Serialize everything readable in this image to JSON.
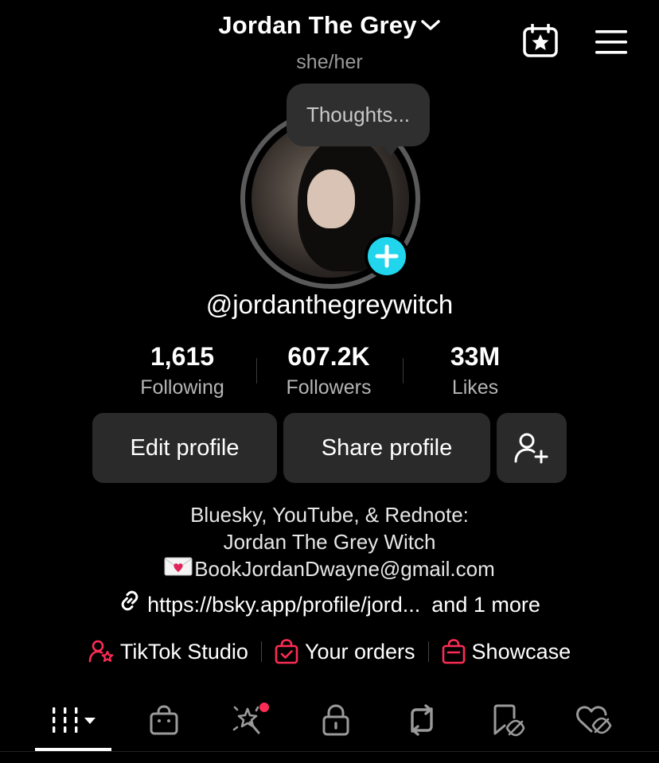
{
  "header": {
    "display_name": "Jordan The Grey",
    "pronouns": "she/her",
    "calendar_icon": "calendar-star-icon",
    "menu_icon": "hamburger-menu-icon"
  },
  "thought_bubble": {
    "text": "Thoughts..."
  },
  "profile": {
    "handle": "@jordanthegreywitch",
    "avatar_alt": "profile photo",
    "add_badge_color": "#20d5ec"
  },
  "stats": [
    {
      "value": "1,615",
      "label": "Following"
    },
    {
      "value": "607.2K",
      "label": "Followers"
    },
    {
      "value": "33M",
      "label": "Likes"
    }
  ],
  "actions": {
    "edit_profile": "Edit profile",
    "share_profile": "Share profile",
    "add_friend_icon": "add-user-icon"
  },
  "bio": {
    "line1": "Bluesky, YouTube, & Rednote:",
    "line2": "Jordan The Grey Witch",
    "line3": "BookJordanDwayne@gmail.com"
  },
  "link": {
    "url": "https://bsky.app/profile/jord...",
    "more": "and 1 more"
  },
  "tools": [
    {
      "label": "TikTok Studio",
      "icon": "creator-star-icon"
    },
    {
      "label": "Your orders",
      "icon": "shopping-bag-check-icon"
    },
    {
      "label": "Showcase",
      "icon": "shopping-bag-icon"
    }
  ],
  "tabs": [
    {
      "icon": "videos-grid-icon",
      "active": true
    },
    {
      "icon": "shop-bag-icon"
    },
    {
      "icon": "sparkle-wand-icon",
      "badge": true
    },
    {
      "icon": "lock-icon"
    },
    {
      "icon": "repost-icon"
    },
    {
      "icon": "favorites-hidden-icon"
    },
    {
      "icon": "liked-hidden-icon"
    }
  ],
  "colors": {
    "accent_red": "#fe2c55",
    "accent_cyan": "#20d5ec",
    "background": "#000000",
    "button_bg": "#2a2a2a"
  }
}
